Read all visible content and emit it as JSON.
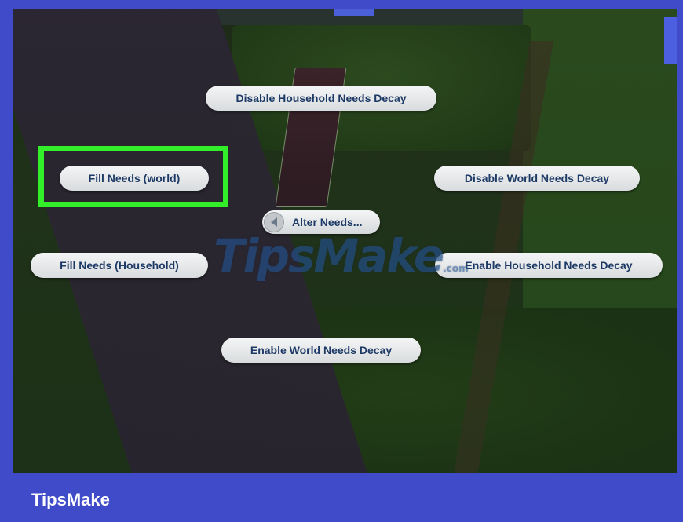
{
  "menu": {
    "disable_household_needs_decay": "Disable Household Needs Decay",
    "fill_needs_world": "Fill Needs (world)",
    "disable_world_needs_decay": "Disable World Needs Decay",
    "alter_needs": "Alter Needs...",
    "fill_needs_household": "Fill Needs (Household)",
    "enable_household_needs_decay": "Enable Household Needs Decay",
    "enable_world_needs_decay": "Enable World Needs Decay"
  },
  "watermark": {
    "brand": "TipsMake",
    "suffix": ".com"
  },
  "footer": {
    "brand": "TipsMake"
  },
  "colors": {
    "frame": "#3f4bc9",
    "highlight": "#33ef2a",
    "button_text": "#1d3a66"
  },
  "icons": {
    "back": "back-arrow-icon"
  }
}
